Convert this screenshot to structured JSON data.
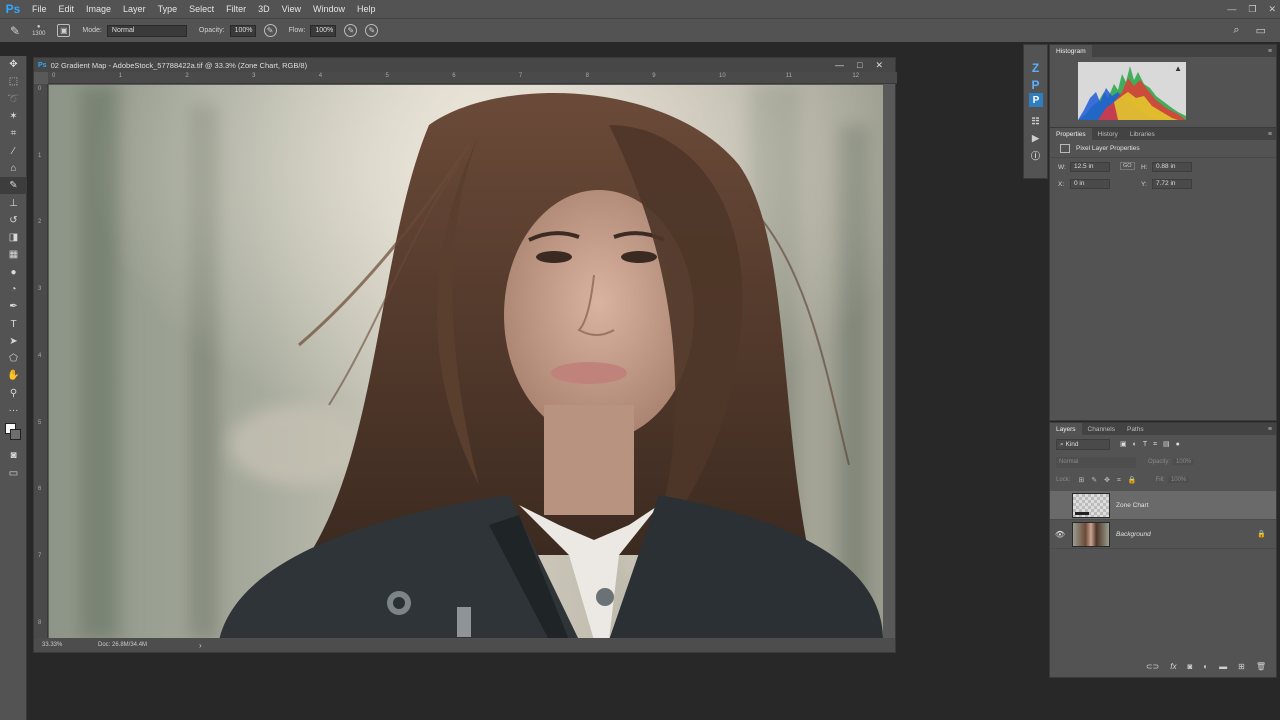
{
  "app": {
    "logo": "Ps"
  },
  "menu": [
    "File",
    "Edit",
    "Image",
    "Layer",
    "Type",
    "Select",
    "Filter",
    "3D",
    "View",
    "Window",
    "Help"
  ],
  "options": {
    "brush_size": "1300",
    "mode_label": "Mode:",
    "mode_value": "Normal",
    "opacity_label": "Opacity:",
    "opacity_value": "100%",
    "flow_label": "Flow:",
    "flow_value": "100%"
  },
  "document": {
    "title": "02 Gradient Map - AdobeStock_57788422a.tif @ 33.3% (Zone Chart, RGB/8)",
    "zoom": "33.33%",
    "doc_size": "Doc: 26.8M/34.4M",
    "ruler_top": [
      "0",
      "1",
      "2",
      "3",
      "4",
      "5",
      "6",
      "7",
      "8",
      "9",
      "10",
      "11",
      "12"
    ],
    "ruler_left": [
      "0",
      "1",
      "2",
      "3",
      "4",
      "5",
      "6",
      "7",
      "8"
    ]
  },
  "histogram": {
    "tab": "Histogram",
    "warning": "▲"
  },
  "properties": {
    "tabs": [
      "Properties",
      "History",
      "Libraries"
    ],
    "section": "Pixel Layer Properties",
    "w_label": "W:",
    "w_value": "12.5 in",
    "link": "GO",
    "h_label": "H:",
    "h_value": "0.88 in",
    "x_label": "X:",
    "x_value": "0 in",
    "y_label": "Y:",
    "y_value": "7.72 in"
  },
  "layers": {
    "tabs": [
      "Layers",
      "Channels",
      "Paths"
    ],
    "filter_kind": "Kind",
    "blend_mode": "Normal",
    "opacity_label": "Opacity:",
    "opacity_value": "100%",
    "lock_label": "Lock:",
    "fill_label": "Fill:",
    "fill_value": "100%",
    "items": [
      {
        "name": "Zone Chart",
        "selected": true,
        "visible": false
      },
      {
        "name": "Background",
        "selected": false,
        "visible": true,
        "locked": true
      }
    ],
    "footer_icons": [
      "link-icon",
      "fx-icon",
      "mask-icon",
      "adjustment-icon",
      "folder-icon",
      "new-layer-icon",
      "trash-icon"
    ]
  },
  "mini_icons": {
    "z": "Z",
    "p": "P",
    "pb": "P"
  },
  "colors": {
    "accent": "#31a8ff",
    "panel": "#535353",
    "workspace": "#282828"
  }
}
